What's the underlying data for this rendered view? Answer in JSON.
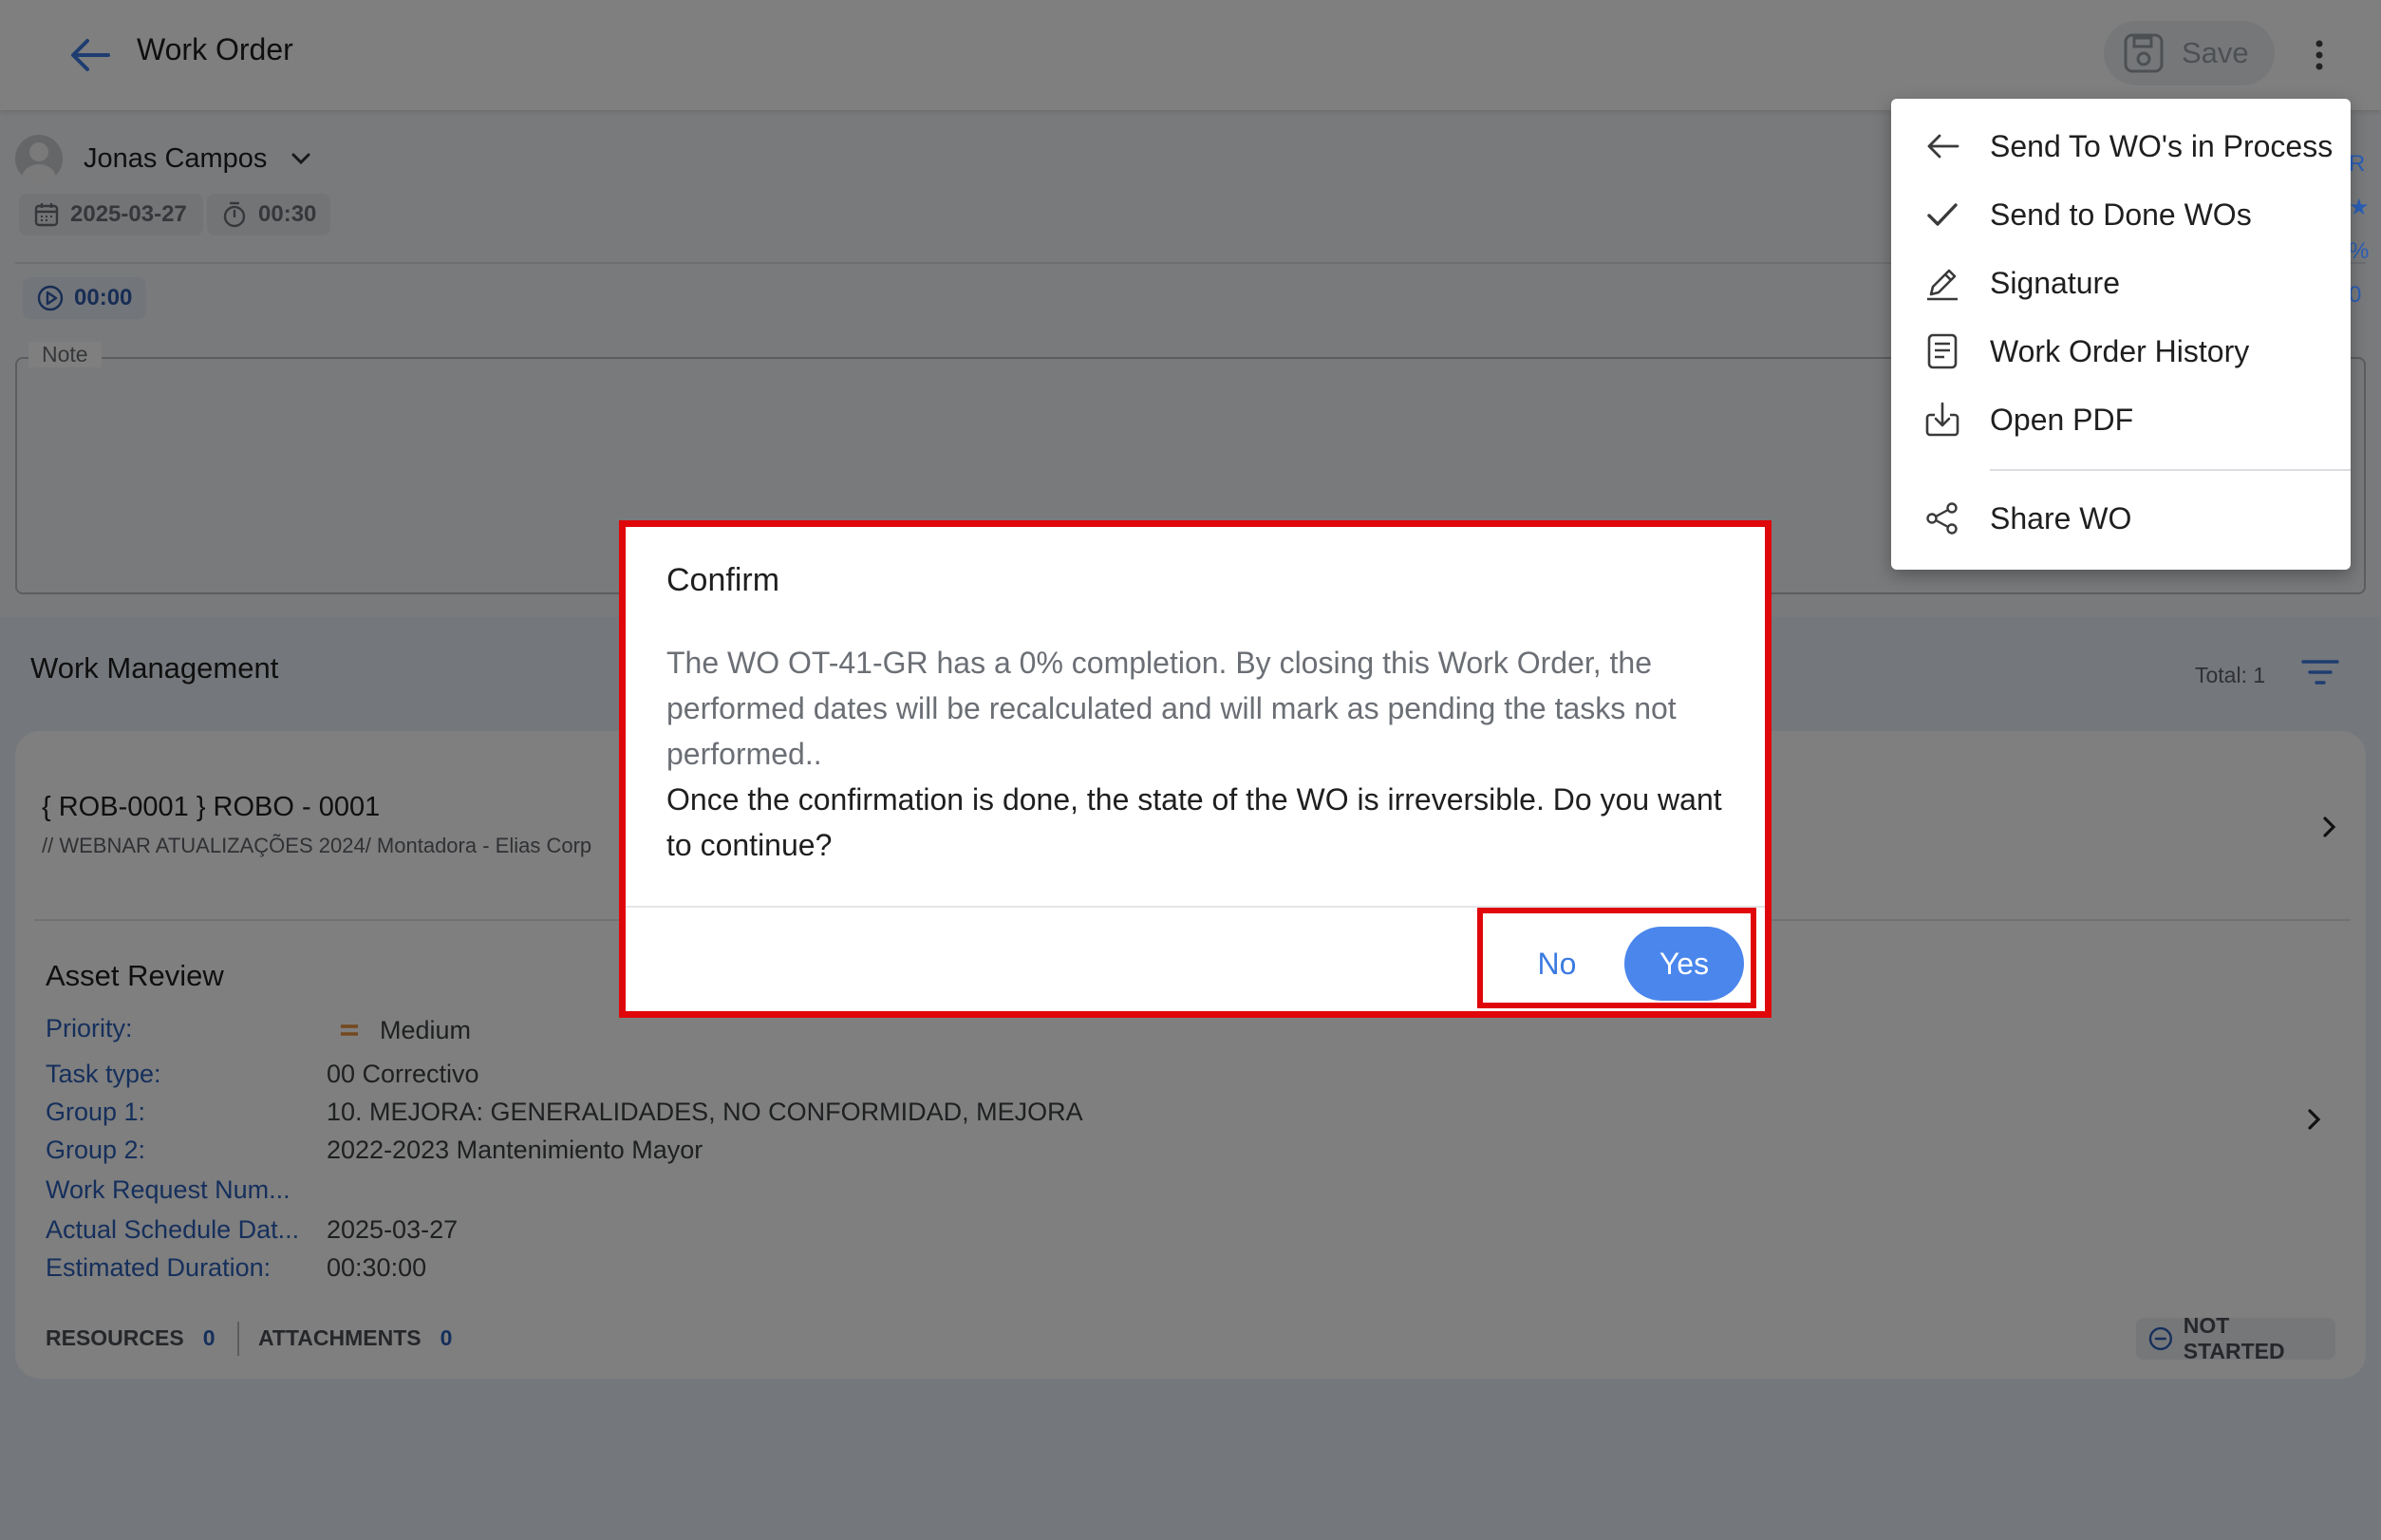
{
  "header": {
    "title": "Work Order",
    "save_label": "Save"
  },
  "work_order": {
    "assignee": "Jonas Campos",
    "date": "2025-03-27",
    "duration": "00:30",
    "timer": "00:00",
    "note_label": "Note"
  },
  "work_management": {
    "title": "Work Management",
    "total_label": "Total: 1",
    "asset": {
      "title": "{ ROB-0001 } ROBO - 0001",
      "path": "// WEBNAR ATUALIZAÇÕES 2024/ Montadora - Elias Corp"
    },
    "review": {
      "title": "Asset Review",
      "fields": [
        {
          "label": "Priority:",
          "value": "Medium"
        },
        {
          "label": "Task type:",
          "value": "00 Correctivo"
        },
        {
          "label": "Group 1:",
          "value": "10. MEJORA: GENERALIDADES, NO CONFORMIDAD, MEJORA"
        },
        {
          "label": "Group 2:",
          "value": "2022-2023 Mantenimiento Mayor"
        },
        {
          "label": "Work Request Num...",
          "value": ""
        },
        {
          "label": "Actual Schedule Dat...",
          "value": "2025-03-27"
        },
        {
          "label": "Estimated Duration:",
          "value": "00:30:00"
        }
      ]
    },
    "footer": {
      "resources_label": "RESOURCES",
      "resources_count": "0",
      "attachments_label": "ATTACHMENTS",
      "attachments_count": "0",
      "status": "NOT STARTED"
    }
  },
  "menu": {
    "items": [
      {
        "label": "Send To WO's in Process",
        "icon": "arrow-left-icon"
      },
      {
        "label": "Send to Done WOs",
        "icon": "check-icon"
      },
      {
        "label": "Signature",
        "icon": "pencil-icon"
      },
      {
        "label": "Work Order History",
        "icon": "document-icon"
      },
      {
        "label": "Open PDF",
        "icon": "download-icon"
      },
      {
        "label": "Share WO",
        "icon": "share-icon"
      }
    ],
    "edge_glyphs": [
      "R",
      "★",
      "%",
      "0"
    ]
  },
  "dialog": {
    "title": "Confirm",
    "message": "The WO OT-41-GR has a 0% completion. By closing this Work Order, the performed dates will be recalculated and will mark as pending the tasks not performed..",
    "warning": "Once the confirmation is done, the state of the WO is irreversible. Do you want to continue?",
    "no_label": "No",
    "yes_label": "Yes"
  },
  "colors": {
    "accent": "#4a86ec",
    "link_label": "#2a5fb8",
    "highlight": "#e0070a",
    "priority_medium": "#e8913a"
  }
}
